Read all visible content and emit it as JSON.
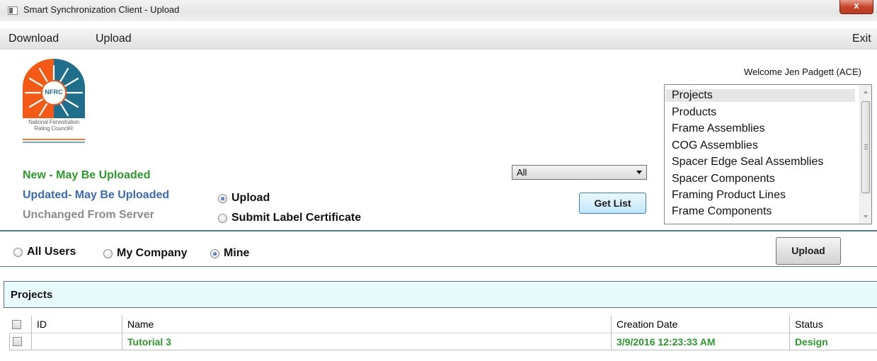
{
  "window": {
    "title": "Smart Synchronization Client - Upload",
    "close_label": "x"
  },
  "menu": {
    "download": "Download",
    "upload": "Upload",
    "exit": "Exit"
  },
  "logo": {
    "acronym": "NFRC",
    "subtitle_line1": "National Fenestration",
    "subtitle_line2": "Rating Council®"
  },
  "welcome": "Welcome Jen Padgett (ACE)",
  "legend": {
    "new": "New - May Be Uploaded",
    "updated": "Updated- May Be Uploaded",
    "unchanged": "Unchanged From Server",
    "colors": {
      "new": "#2a9a2a",
      "updated": "#3a6ab8",
      "unchanged": "#8a8a8a"
    }
  },
  "mode_radios": {
    "upload": "Upload",
    "submit_label_certificate": "Submit Label Certificate",
    "selected": "Upload"
  },
  "filter_dropdown": {
    "value": "All"
  },
  "get_list_button": "Get List",
  "type_list": {
    "items": [
      "Projects",
      "Products",
      "Frame Assemblies",
      "COG Assemblies",
      "Spacer Edge Seal Assemblies",
      "Spacer Components",
      "Framing Product Lines",
      "Frame Components"
    ],
    "selected": "Projects"
  },
  "owner_radios": {
    "all_users": "All Users",
    "my_company": "My Company",
    "mine": "Mine",
    "selected": "Mine"
  },
  "upload_button": "Upload",
  "projects_section": {
    "title": "Projects"
  },
  "grid": {
    "columns": {
      "id": "ID",
      "name": "Name",
      "creation_date": "Creation Date",
      "status": "Status"
    },
    "rows": [
      {
        "id": "",
        "name": "Tutorial 3",
        "creation_date": "3/9/2016 12:23:33 AM",
        "status": "Design",
        "checked": false
      }
    ]
  }
}
